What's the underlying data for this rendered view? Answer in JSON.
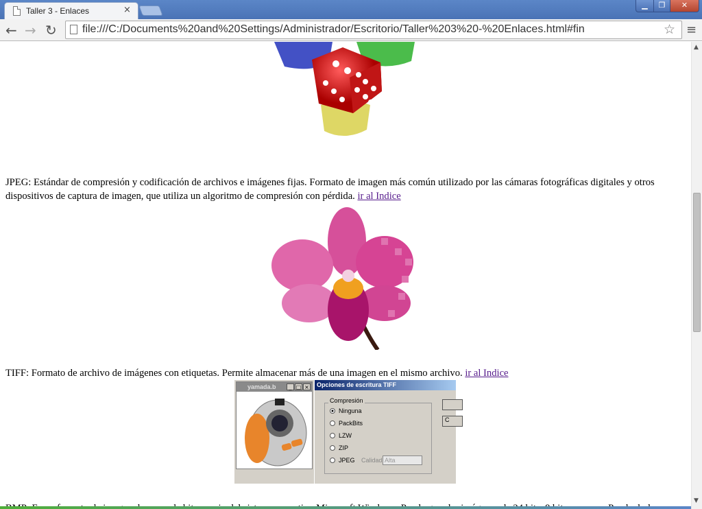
{
  "window": {
    "tab_title": "Taller 3 - Enlaces",
    "tab_close": "×",
    "min": "▁",
    "max": "❐",
    "close": "✕"
  },
  "toolbar": {
    "back": "←",
    "forward": "→",
    "reload": "↻",
    "url": "file:///C:/Documents%20and%20Settings/Administrador/Escritorio/Taller%203%20-%20Enlaces.html#fin",
    "star": "☆",
    "menu": "≡"
  },
  "content": {
    "jpeg_text": "JPEG: Estándar de compresión y codificación de archivos e imágenes fijas. Formato de imagen más común utilizado por las cámaras fotográficas digitales y otros dispositivos de captura de imagen, que utiliza un algoritmo de compresión con pérdida.",
    "jpeg_link": "ir al Indice",
    "tiff_text": "TIFF: Formato de archivo de imágenes con etiquetas.  Permite almacenar más de una imagen en el mismo archivo.",
    "tiff_link": "ir al Indice",
    "bmp_text": "BMP: Es un formato de imagen de mapa de bits propio del sistema operativo Microsoft Windows. Puede guardar imágenes de 24 bits, 8 bits o menos. Puede darle"
  },
  "tiff_image": {
    "window_title": "yamada.b",
    "dialog_title": "Opciones de escritura TIFF",
    "group_label": "Compresión",
    "options": [
      "Ninguna",
      "PackBits",
      "LZW",
      "ZIP",
      "JPEG"
    ],
    "selected": "Ninguna",
    "quality_label": "Calidad",
    "quality_value": "Alta",
    "button_cancel_partial": "C"
  },
  "colors": {
    "titlebar": "#4a73b6",
    "link": "#551a8b"
  }
}
